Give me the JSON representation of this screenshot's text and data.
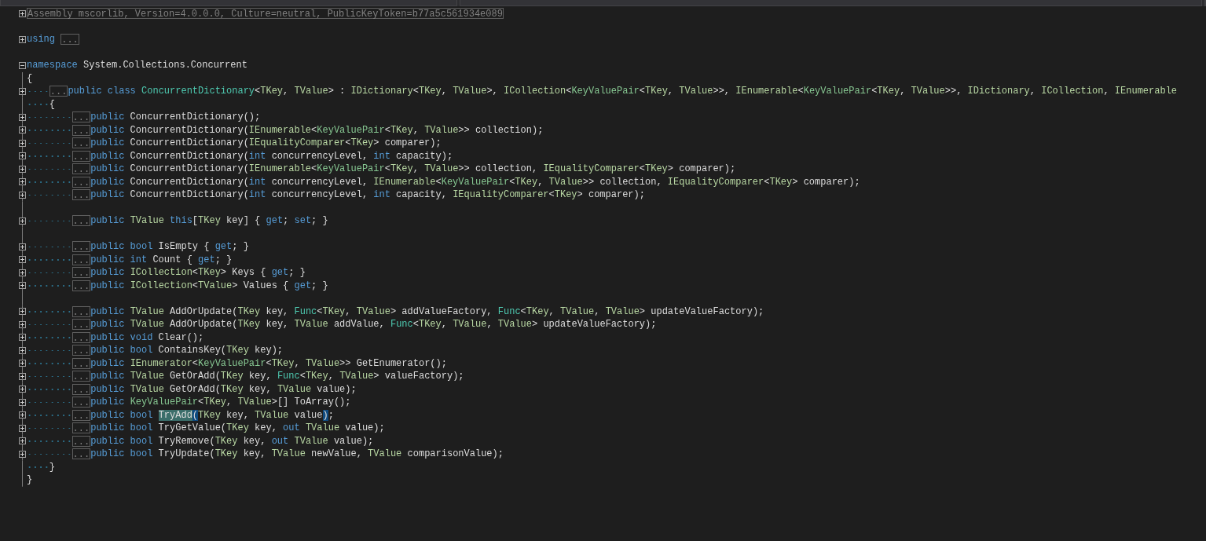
{
  "navigation_bar": {
    "dropdowns": [
      {
        "selected": false
      },
      {
        "selected": false
      },
      {
        "selected": false
      }
    ]
  },
  "code": [
    {
      "kind": "code",
      "expanded": false,
      "tokens": [
        {
          "kind": "collapsed",
          "text": "Assembly mscorlib, Version=4.0.0.0, Culture=neutral, PublicKeyToken=b77a5c561934e089"
        }
      ]
    },
    {
      "kind": "blank"
    },
    {
      "kind": "code",
      "expanded": false,
      "tokens": [
        {
          "kind": "kw",
          "text": "using "
        },
        {
          "kind": "collapsed",
          "text": "..."
        }
      ]
    },
    {
      "kind": "blank"
    },
    {
      "kind": "code",
      "expanded": true,
      "tokens": [
        {
          "kind": "kw",
          "text": "namespace"
        },
        {
          "kind": "plain",
          "text": " System.Collections.Concurrent"
        }
      ]
    },
    {
      "kind": "code",
      "tokens": [
        {
          "kind": "plain",
          "text": "{"
        }
      ],
      "children": [
        {
          "kind": "code",
          "expanded": false,
          "tokens": [
            {
              "kind": "collapsed",
              "text": "..."
            },
            {
              "kind": "kw",
              "text": "public class "
            },
            {
              "kind": "cls",
              "text": "ConcurrentDictionary"
            },
            {
              "kind": "plain",
              "text": "<"
            },
            {
              "kind": "tp",
              "text": "TKey"
            },
            {
              "kind": "plain",
              "text": ", "
            },
            {
              "kind": "tp",
              "text": "TValue"
            },
            {
              "kind": "plain",
              "text": "> : "
            },
            {
              "kind": "tp",
              "text": "IDictionary"
            },
            {
              "kind": "plain",
              "text": "<"
            },
            {
              "kind": "tp",
              "text": "TKey"
            },
            {
              "kind": "plain",
              "text": ", "
            },
            {
              "kind": "tp",
              "text": "TValue"
            },
            {
              "kind": "plain",
              "text": ">, "
            },
            {
              "kind": "tp",
              "text": "ICollection"
            },
            {
              "kind": "plain",
              "text": "<"
            },
            {
              "kind": "st",
              "text": "KeyValuePair"
            },
            {
              "kind": "plain",
              "text": "<"
            },
            {
              "kind": "tp",
              "text": "TKey"
            },
            {
              "kind": "plain",
              "text": ", "
            },
            {
              "kind": "tp",
              "text": "TValue"
            },
            {
              "kind": "plain",
              "text": ">>, "
            },
            {
              "kind": "tp",
              "text": "IEnumerable"
            },
            {
              "kind": "plain",
              "text": "<"
            },
            {
              "kind": "st",
              "text": "KeyValuePair"
            },
            {
              "kind": "plain",
              "text": "<"
            },
            {
              "kind": "tp",
              "text": "TKey"
            },
            {
              "kind": "plain",
              "text": ", "
            },
            {
              "kind": "tp",
              "text": "TValue"
            },
            {
              "kind": "plain",
              "text": ">>, "
            },
            {
              "kind": "tp",
              "text": "IDictionary"
            },
            {
              "kind": "plain",
              "text": ", "
            },
            {
              "kind": "tp",
              "text": "ICollection"
            },
            {
              "kind": "plain",
              "text": ", "
            },
            {
              "kind": "tp",
              "text": "IEnumerable"
            }
          ]
        },
        {
          "kind": "code",
          "tokens": [
            {
              "kind": "plain",
              "text": "{"
            }
          ],
          "children": [
            {
              "kind": "code",
              "expanded": false,
              "tokens": [
                {
                  "kind": "collapsed",
                  "text": "..."
                },
                {
                  "kind": "kw",
                  "text": "public"
                },
                {
                  "kind": "plain",
                  "text": " ConcurrentDictionary();"
                }
              ]
            },
            {
              "kind": "code",
              "expanded": false,
              "tokens": [
                {
                  "kind": "collapsed",
                  "text": "..."
                },
                {
                  "kind": "kw",
                  "text": "public"
                },
                {
                  "kind": "plain",
                  "text": " ConcurrentDictionary("
                },
                {
                  "kind": "tp",
                  "text": "IEnumerable"
                },
                {
                  "kind": "plain",
                  "text": "<"
                },
                {
                  "kind": "st",
                  "text": "KeyValuePair"
                },
                {
                  "kind": "plain",
                  "text": "<"
                },
                {
                  "kind": "tp",
                  "text": "TKey"
                },
                {
                  "kind": "plain",
                  "text": ", "
                },
                {
                  "kind": "tp",
                  "text": "TValue"
                },
                {
                  "kind": "plain",
                  "text": ">> collection);"
                }
              ]
            },
            {
              "kind": "code",
              "expanded": false,
              "tokens": [
                {
                  "kind": "collapsed",
                  "text": "..."
                },
                {
                  "kind": "kw",
                  "text": "public"
                },
                {
                  "kind": "plain",
                  "text": " ConcurrentDictionary("
                },
                {
                  "kind": "tp",
                  "text": "IEqualityComparer"
                },
                {
                  "kind": "plain",
                  "text": "<"
                },
                {
                  "kind": "tp",
                  "text": "TKey"
                },
                {
                  "kind": "plain",
                  "text": "> comparer);"
                }
              ]
            },
            {
              "kind": "code",
              "expanded": false,
              "tokens": [
                {
                  "kind": "collapsed",
                  "text": "..."
                },
                {
                  "kind": "kw",
                  "text": "public"
                },
                {
                  "kind": "plain",
                  "text": " ConcurrentDictionary("
                },
                {
                  "kind": "kw",
                  "text": "int"
                },
                {
                  "kind": "plain",
                  "text": " concurrencyLevel, "
                },
                {
                  "kind": "kw",
                  "text": "int"
                },
                {
                  "kind": "plain",
                  "text": " capacity);"
                }
              ]
            },
            {
              "kind": "code",
              "expanded": false,
              "tokens": [
                {
                  "kind": "collapsed",
                  "text": "..."
                },
                {
                  "kind": "kw",
                  "text": "public"
                },
                {
                  "kind": "plain",
                  "text": " ConcurrentDictionary("
                },
                {
                  "kind": "tp",
                  "text": "IEnumerable"
                },
                {
                  "kind": "plain",
                  "text": "<"
                },
                {
                  "kind": "st",
                  "text": "KeyValuePair"
                },
                {
                  "kind": "plain",
                  "text": "<"
                },
                {
                  "kind": "tp",
                  "text": "TKey"
                },
                {
                  "kind": "plain",
                  "text": ", "
                },
                {
                  "kind": "tp",
                  "text": "TValue"
                },
                {
                  "kind": "plain",
                  "text": ">> collection, "
                },
                {
                  "kind": "tp",
                  "text": "IEqualityComparer"
                },
                {
                  "kind": "plain",
                  "text": "<"
                },
                {
                  "kind": "tp",
                  "text": "TKey"
                },
                {
                  "kind": "plain",
                  "text": "> comparer);"
                }
              ]
            },
            {
              "kind": "code",
              "expanded": false,
              "tokens": [
                {
                  "kind": "collapsed",
                  "text": "..."
                },
                {
                  "kind": "kw",
                  "text": "public"
                },
                {
                  "kind": "plain",
                  "text": " ConcurrentDictionary("
                },
                {
                  "kind": "kw",
                  "text": "int"
                },
                {
                  "kind": "plain",
                  "text": " concurrencyLevel, "
                },
                {
                  "kind": "tp",
                  "text": "IEnumerable"
                },
                {
                  "kind": "plain",
                  "text": "<"
                },
                {
                  "kind": "st",
                  "text": "KeyValuePair"
                },
                {
                  "kind": "plain",
                  "text": "<"
                },
                {
                  "kind": "tp",
                  "text": "TKey"
                },
                {
                  "kind": "plain",
                  "text": ", "
                },
                {
                  "kind": "tp",
                  "text": "TValue"
                },
                {
                  "kind": "plain",
                  "text": ">> collection, "
                },
                {
                  "kind": "tp",
                  "text": "IEqualityComparer"
                },
                {
                  "kind": "plain",
                  "text": "<"
                },
                {
                  "kind": "tp",
                  "text": "TKey"
                },
                {
                  "kind": "plain",
                  "text": "> comparer);"
                }
              ]
            },
            {
              "kind": "code",
              "expanded": false,
              "tokens": [
                {
                  "kind": "collapsed",
                  "text": "..."
                },
                {
                  "kind": "kw",
                  "text": "public"
                },
                {
                  "kind": "plain",
                  "text": " ConcurrentDictionary("
                },
                {
                  "kind": "kw",
                  "text": "int"
                },
                {
                  "kind": "plain",
                  "text": " concurrencyLevel, "
                },
                {
                  "kind": "kw",
                  "text": "int"
                },
                {
                  "kind": "plain",
                  "text": " capacity, "
                },
                {
                  "kind": "tp",
                  "text": "IEqualityComparer"
                },
                {
                  "kind": "plain",
                  "text": "<"
                },
                {
                  "kind": "tp",
                  "text": "TKey"
                },
                {
                  "kind": "plain",
                  "text": "> comparer);"
                }
              ]
            },
            {
              "kind": "blank"
            },
            {
              "kind": "code",
              "expanded": false,
              "tokens": [
                {
                  "kind": "collapsed",
                  "text": "..."
                },
                {
                  "kind": "kw",
                  "text": "public "
                },
                {
                  "kind": "tp",
                  "text": "TValue "
                },
                {
                  "kind": "kw",
                  "text": "this"
                },
                {
                  "kind": "plain",
                  "text": "["
                },
                {
                  "kind": "tp",
                  "text": "TKey"
                },
                {
                  "kind": "plain",
                  "text": " key] { "
                },
                {
                  "kind": "kw",
                  "text": "get"
                },
                {
                  "kind": "plain",
                  "text": "; "
                },
                {
                  "kind": "kw",
                  "text": "set"
                },
                {
                  "kind": "plain",
                  "text": "; }"
                }
              ]
            },
            {
              "kind": "blank"
            },
            {
              "kind": "code",
              "expanded": false,
              "tokens": [
                {
                  "kind": "collapsed",
                  "text": "..."
                },
                {
                  "kind": "kw",
                  "text": "public bool"
                },
                {
                  "kind": "plain",
                  "text": " IsEmpty { "
                },
                {
                  "kind": "kw",
                  "text": "get"
                },
                {
                  "kind": "plain",
                  "text": "; }"
                }
              ]
            },
            {
              "kind": "code",
              "expanded": false,
              "tokens": [
                {
                  "kind": "collapsed",
                  "text": "..."
                },
                {
                  "kind": "kw",
                  "text": "public int"
                },
                {
                  "kind": "plain",
                  "text": " Count { "
                },
                {
                  "kind": "kw",
                  "text": "get"
                },
                {
                  "kind": "plain",
                  "text": "; }"
                }
              ]
            },
            {
              "kind": "code",
              "expanded": false,
              "tokens": [
                {
                  "kind": "collapsed",
                  "text": "..."
                },
                {
                  "kind": "kw",
                  "text": "public "
                },
                {
                  "kind": "tp",
                  "text": "ICollection"
                },
                {
                  "kind": "plain",
                  "text": "<"
                },
                {
                  "kind": "tp",
                  "text": "TKey"
                },
                {
                  "kind": "plain",
                  "text": "> Keys { "
                },
                {
                  "kind": "kw",
                  "text": "get"
                },
                {
                  "kind": "plain",
                  "text": "; }"
                }
              ]
            },
            {
              "kind": "code",
              "expanded": false,
              "tokens": [
                {
                  "kind": "collapsed",
                  "text": "..."
                },
                {
                  "kind": "kw",
                  "text": "public "
                },
                {
                  "kind": "tp",
                  "text": "ICollection"
                },
                {
                  "kind": "plain",
                  "text": "<"
                },
                {
                  "kind": "tp",
                  "text": "TValue"
                },
                {
                  "kind": "plain",
                  "text": "> Values { "
                },
                {
                  "kind": "kw",
                  "text": "get"
                },
                {
                  "kind": "plain",
                  "text": "; }"
                }
              ]
            },
            {
              "kind": "blank"
            },
            {
              "kind": "code",
              "expanded": false,
              "tokens": [
                {
                  "kind": "collapsed",
                  "text": "..."
                },
                {
                  "kind": "kw",
                  "text": "public "
                },
                {
                  "kind": "tp",
                  "text": "TValue"
                },
                {
                  "kind": "plain",
                  "text": " AddOrUpdate("
                },
                {
                  "kind": "tp",
                  "text": "TKey"
                },
                {
                  "kind": "plain",
                  "text": " key, "
                },
                {
                  "kind": "cls",
                  "text": "Func"
                },
                {
                  "kind": "plain",
                  "text": "<"
                },
                {
                  "kind": "tp",
                  "text": "TKey"
                },
                {
                  "kind": "plain",
                  "text": ", "
                },
                {
                  "kind": "tp",
                  "text": "TValue"
                },
                {
                  "kind": "plain",
                  "text": "> addValueFactory, "
                },
                {
                  "kind": "cls",
                  "text": "Func"
                },
                {
                  "kind": "plain",
                  "text": "<"
                },
                {
                  "kind": "tp",
                  "text": "TKey"
                },
                {
                  "kind": "plain",
                  "text": ", "
                },
                {
                  "kind": "tp",
                  "text": "TValue"
                },
                {
                  "kind": "plain",
                  "text": ", "
                },
                {
                  "kind": "tp",
                  "text": "TValue"
                },
                {
                  "kind": "plain",
                  "text": "> updateValueFactory);"
                }
              ]
            },
            {
              "kind": "code",
              "expanded": false,
              "tokens": [
                {
                  "kind": "collapsed",
                  "text": "..."
                },
                {
                  "kind": "kw",
                  "text": "public "
                },
                {
                  "kind": "tp",
                  "text": "TValue"
                },
                {
                  "kind": "plain",
                  "text": " AddOrUpdate("
                },
                {
                  "kind": "tp",
                  "text": "TKey"
                },
                {
                  "kind": "plain",
                  "text": " key, "
                },
                {
                  "kind": "tp",
                  "text": "TValue"
                },
                {
                  "kind": "plain",
                  "text": " addValue, "
                },
                {
                  "kind": "cls",
                  "text": "Func"
                },
                {
                  "kind": "plain",
                  "text": "<"
                },
                {
                  "kind": "tp",
                  "text": "TKey"
                },
                {
                  "kind": "plain",
                  "text": ", "
                },
                {
                  "kind": "tp",
                  "text": "TValue"
                },
                {
                  "kind": "plain",
                  "text": ", "
                },
                {
                  "kind": "tp",
                  "text": "TValue"
                },
                {
                  "kind": "plain",
                  "text": "> updateValueFactory);"
                }
              ]
            },
            {
              "kind": "code",
              "expanded": false,
              "tokens": [
                {
                  "kind": "collapsed",
                  "text": "..."
                },
                {
                  "kind": "kw",
                  "text": "public void"
                },
                {
                  "kind": "plain",
                  "text": " Clear();"
                }
              ]
            },
            {
              "kind": "code",
              "expanded": false,
              "tokens": [
                {
                  "kind": "collapsed",
                  "text": "..."
                },
                {
                  "kind": "kw",
                  "text": "public bool"
                },
                {
                  "kind": "plain",
                  "text": " ContainsKey("
                },
                {
                  "kind": "tp",
                  "text": "TKey"
                },
                {
                  "kind": "plain",
                  "text": " key);"
                }
              ]
            },
            {
              "kind": "code",
              "expanded": false,
              "tokens": [
                {
                  "kind": "collapsed",
                  "text": "..."
                },
                {
                  "kind": "kw",
                  "text": "public "
                },
                {
                  "kind": "tp",
                  "text": "IEnumerator"
                },
                {
                  "kind": "plain",
                  "text": "<"
                },
                {
                  "kind": "st",
                  "text": "KeyValuePair"
                },
                {
                  "kind": "plain",
                  "text": "<"
                },
                {
                  "kind": "tp",
                  "text": "TKey"
                },
                {
                  "kind": "plain",
                  "text": ", "
                },
                {
                  "kind": "tp",
                  "text": "TValue"
                },
                {
                  "kind": "plain",
                  "text": ">> GetEnumerator();"
                }
              ]
            },
            {
              "kind": "code",
              "expanded": false,
              "tokens": [
                {
                  "kind": "collapsed",
                  "text": "..."
                },
                {
                  "kind": "kw",
                  "text": "public "
                },
                {
                  "kind": "tp",
                  "text": "TValue"
                },
                {
                  "kind": "plain",
                  "text": " GetOrAdd("
                },
                {
                  "kind": "tp",
                  "text": "TKey"
                },
                {
                  "kind": "plain",
                  "text": " key, "
                },
                {
                  "kind": "cls",
                  "text": "Func"
                },
                {
                  "kind": "plain",
                  "text": "<"
                },
                {
                  "kind": "tp",
                  "text": "TKey"
                },
                {
                  "kind": "plain",
                  "text": ", "
                },
                {
                  "kind": "tp",
                  "text": "TValue"
                },
                {
                  "kind": "plain",
                  "text": "> valueFactory);"
                }
              ]
            },
            {
              "kind": "code",
              "expanded": false,
              "tokens": [
                {
                  "kind": "collapsed",
                  "text": "..."
                },
                {
                  "kind": "kw",
                  "text": "public "
                },
                {
                  "kind": "tp",
                  "text": "TValue"
                },
                {
                  "kind": "plain",
                  "text": " GetOrAdd("
                },
                {
                  "kind": "tp",
                  "text": "TKey"
                },
                {
                  "kind": "plain",
                  "text": " key, "
                },
                {
                  "kind": "tp",
                  "text": "TValue"
                },
                {
                  "kind": "plain",
                  "text": " value);"
                }
              ]
            },
            {
              "kind": "code",
              "expanded": false,
              "tokens": [
                {
                  "kind": "collapsed",
                  "text": "..."
                },
                {
                  "kind": "kw",
                  "text": "public "
                },
                {
                  "kind": "st",
                  "text": "KeyValuePair"
                },
                {
                  "kind": "plain",
                  "text": "<"
                },
                {
                  "kind": "tp",
                  "text": "TKey"
                },
                {
                  "kind": "plain",
                  "text": ", "
                },
                {
                  "kind": "tp",
                  "text": "TValue"
                },
                {
                  "kind": "plain",
                  "text": ">[] ToArray();"
                }
              ]
            },
            {
              "kind": "code",
              "expanded": false,
              "tokens": [
                {
                  "kind": "collapsed",
                  "text": "..."
                },
                {
                  "kind": "kw",
                  "text": "public bool "
                },
                {
                  "kind": "hl",
                  "text": "TryAdd"
                },
                {
                  "kind": "match",
                  "text": "("
                },
                {
                  "kind": "tp",
                  "text": "TKey"
                },
                {
                  "kind": "plain",
                  "text": " key, "
                },
                {
                  "kind": "tp",
                  "text": "TValue"
                },
                {
                  "kind": "plain",
                  "text": " value"
                },
                {
                  "kind": "match",
                  "text": ")"
                },
                {
                  "kind": "plain",
                  "text": ";"
                }
              ]
            },
            {
              "kind": "code",
              "expanded": false,
              "tokens": [
                {
                  "kind": "collapsed",
                  "text": "..."
                },
                {
                  "kind": "kw",
                  "text": "public bool"
                },
                {
                  "kind": "plain",
                  "text": " TryGetValue("
                },
                {
                  "kind": "tp",
                  "text": "TKey"
                },
                {
                  "kind": "plain",
                  "text": " key, "
                },
                {
                  "kind": "kw",
                  "text": "out "
                },
                {
                  "kind": "tp",
                  "text": "TValue"
                },
                {
                  "kind": "plain",
                  "text": " value);"
                }
              ]
            },
            {
              "kind": "code",
              "expanded": false,
              "tokens": [
                {
                  "kind": "collapsed",
                  "text": "..."
                },
                {
                  "kind": "kw",
                  "text": "public bool"
                },
                {
                  "kind": "plain",
                  "text": " TryRemove("
                },
                {
                  "kind": "tp",
                  "text": "TKey"
                },
                {
                  "kind": "plain",
                  "text": " key, "
                },
                {
                  "kind": "kw",
                  "text": "out "
                },
                {
                  "kind": "tp",
                  "text": "TValue"
                },
                {
                  "kind": "plain",
                  "text": " value);"
                }
              ]
            },
            {
              "kind": "code",
              "expanded": false,
              "tokens": [
                {
                  "kind": "collapsed",
                  "text": "..."
                },
                {
                  "kind": "kw",
                  "text": "public bool"
                },
                {
                  "kind": "plain",
                  "text": " TryUpdate("
                },
                {
                  "kind": "tp",
                  "text": "TKey"
                },
                {
                  "kind": "plain",
                  "text": " key, "
                },
                {
                  "kind": "tp",
                  "text": "TValue"
                },
                {
                  "kind": "plain",
                  "text": " newValue, "
                },
                {
                  "kind": "tp",
                  "text": "TValue"
                },
                {
                  "kind": "plain",
                  "text": " comparisonValue);"
                }
              ]
            }
          ]
        },
        {
          "kind": "code",
          "tokens": [
            {
              "kind": "plain",
              "text": "}"
            }
          ]
        }
      ]
    },
    {
      "kind": "code",
      "tokens": [
        {
          "kind": "plain",
          "text": "}"
        }
      ]
    }
  ]
}
